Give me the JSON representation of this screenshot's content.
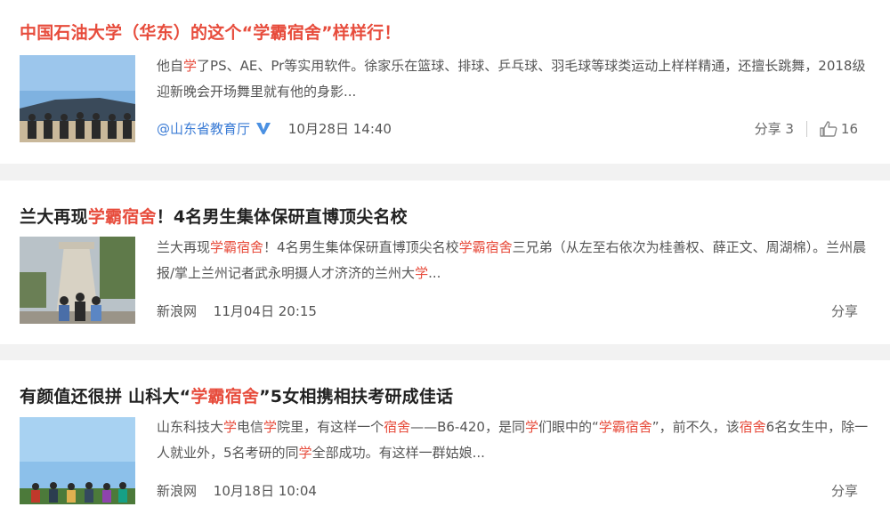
{
  "articles": [
    {
      "title": "中国石油大学（华东）的这个“学霸宿舍”样样行！",
      "excerpt": [
        {
          "t": "他自",
          "h": false
        },
        {
          "t": "学",
          "h": true
        },
        {
          "t": "了PS、AE、Pr等实用软件。徐家乐在篮球、排球、乒乓球、羽毛球等球类运动上样样精通，还擅长跳舞，2018级迎新晚会开场舞里就有他的身影...",
          "h": false
        }
      ],
      "source": "@山东省教育厅",
      "date": "10月28日 14:40",
      "share": "分享 3",
      "likes": "16"
    },
    {
      "title_parts": [
        {
          "t": "兰大再现",
          "h": false
        },
        {
          "t": "学霸宿舍",
          "h": true
        },
        {
          "t": "！4名男生集体保研直博顶尖名校",
          "h": false
        }
      ],
      "excerpt": [
        {
          "t": "兰大再现",
          "h": false
        },
        {
          "t": "学霸宿舍",
          "h": true
        },
        {
          "t": "！4名男生集体保研直博顶尖名校",
          "h": false
        },
        {
          "t": "学霸宿舍",
          "h": true
        },
        {
          "t": "三兄弟（从左至右依次为桂善权、薛正文、周湖棉）。兰州晨报/掌上兰州记者武永明摄人才济济的兰州大",
          "h": false
        },
        {
          "t": "学",
          "h": true
        },
        {
          "t": "...",
          "h": false
        }
      ],
      "source": "新浪网",
      "date": "11月04日 20:15",
      "share": "分享"
    },
    {
      "title_parts": [
        {
          "t": "有颜值还很拼 山科大“",
          "h": false
        },
        {
          "t": "学霸宿舍",
          "h": true
        },
        {
          "t": "”5女相携相扶考研成佳话",
          "h": false
        }
      ],
      "excerpt": [
        {
          "t": "山东科技大",
          "h": false
        },
        {
          "t": "学",
          "h": true
        },
        {
          "t": "电信",
          "h": false
        },
        {
          "t": "学",
          "h": true
        },
        {
          "t": "院里，有这样一个",
          "h": false
        },
        {
          "t": "宿舍",
          "h": true
        },
        {
          "t": "——B6-420，是同",
          "h": false
        },
        {
          "t": "学",
          "h": true
        },
        {
          "t": "们眼中的“",
          "h": false
        },
        {
          "t": "学霸宿舍",
          "h": true
        },
        {
          "t": "”，前不久，该",
          "h": false
        },
        {
          "t": "宿舍",
          "h": true
        },
        {
          "t": "6名女生中，除一人就业外，5名考研的同",
          "h": false
        },
        {
          "t": "学",
          "h": true
        },
        {
          "t": "全部成功。有这样一群姑娘...",
          "h": false
        }
      ],
      "source": "新浪网",
      "date": "10月18日 10:04",
      "share": "分享"
    }
  ],
  "colors": {
    "accent": "#e74c3c",
    "link": "#3a7bd5",
    "text": "#222222",
    "muted": "#555555",
    "background": "#f2f2f2"
  },
  "icons": {
    "verified": "verified-v-icon",
    "like": "thumbs-up-icon"
  }
}
